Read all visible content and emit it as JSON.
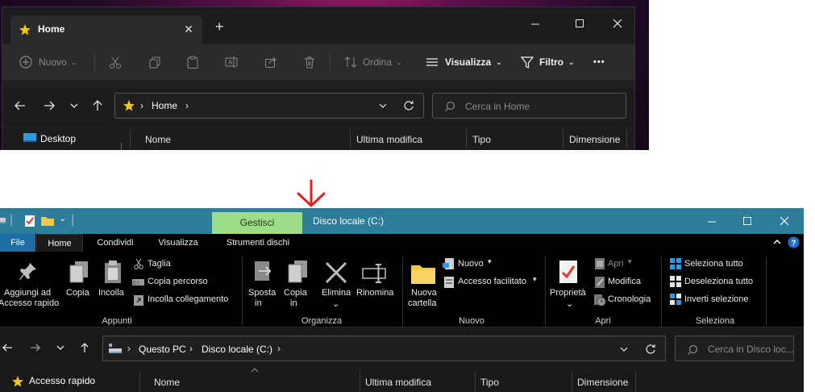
{
  "top_window": {
    "tab_label": "Home",
    "new_tab_symbol": "+",
    "toolbar": {
      "new_label": "Nuovo",
      "sort_label": "Ordina",
      "view_label": "Visualizza",
      "filter_label": "Filtro",
      "more_label": "•••"
    },
    "breadcrumb": [
      "Home"
    ],
    "search_placeholder": "Cerca in Home",
    "sidebar_item": "Desktop",
    "columns": [
      "Nome",
      "Ultima modifica",
      "Tipo",
      "Dimensione"
    ]
  },
  "bottom_window": {
    "title": "Disco locale (C:)",
    "contextual_tab": "Gestisci",
    "tabs": [
      "File",
      "Home",
      "Condividi",
      "Visualizza",
      "Strumenti dischi"
    ],
    "ribbon": {
      "appunti": {
        "group_label": "Appunti",
        "pin_label_1": "Aggiungi ad",
        "pin_label_2": "Accesso rapido",
        "copy_label": "Copia",
        "paste_label": "Incolla",
        "cut_label": "Taglia",
        "copy_path_label": "Copia percorso",
        "paste_link_label": "Incolla collegamento"
      },
      "organizza": {
        "group_label": "Organizza",
        "move_label_1": "Sposta",
        "move_label_2": "in",
        "copyto_label_1": "Copia",
        "copyto_label_2": "in",
        "delete_label": "Elimina",
        "rename_label": "Rinomina"
      },
      "nuovo": {
        "group_label": "Nuovo",
        "new_folder_1": "Nuova",
        "new_folder_2": "cartella",
        "new_item_label": "Nuovo",
        "easy_access_label": "Accesso facilitato"
      },
      "apri": {
        "group_label": "Apri",
        "properties_label": "Proprietà",
        "open_label": "Apri",
        "edit_label": "Modifica",
        "history_label": "Cronologia"
      },
      "seleziona": {
        "group_label": "Seleziona",
        "select_all": "Seleziona tutto",
        "deselect_all": "Deseleziona tutto",
        "invert": "Inverti selezione"
      }
    },
    "breadcrumb": [
      "Questo PC",
      "Disco locale (C:)"
    ],
    "search_placeholder": "Cerca in Disco loc...",
    "sidebar_item": "Accesso rapido",
    "columns": [
      "Nome",
      "Ultima modifica",
      "Tipo",
      "Dimensione"
    ]
  },
  "colors": {
    "accent_title": "#2d7d9a",
    "contextual_green": "#9ddd88",
    "arrow": "#e02020",
    "star": "#f5c518"
  }
}
